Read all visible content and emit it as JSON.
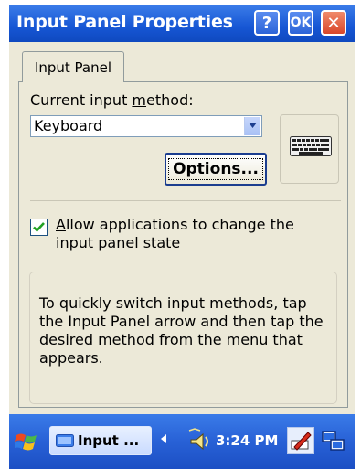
{
  "window": {
    "title": "Input Panel Properties",
    "help_label": "?",
    "ok_label": "OK",
    "close_label": "✕"
  },
  "tabs": [
    {
      "label": "Input Panel",
      "selected": true
    }
  ],
  "input_method": {
    "label_pre": "Current input ",
    "label_mnemonic": "m",
    "label_post": "ethod:",
    "selected_value": "Keyboard",
    "options_button": "Options..."
  },
  "checkbox": {
    "mnemonic": "A",
    "label_rest": "llow applications to change the input panel state",
    "checked": true
  },
  "info": {
    "text": "To quickly switch input methods, tap the Input Panel arrow and then tap the desired method from the menu that appears."
  },
  "taskbar": {
    "task_button_label": "Input ...",
    "clock": "3:24 PM"
  },
  "icons": {
    "start": "windows-flag-icon",
    "keyboard": "keyboard-icon",
    "pen": "input-pen-icon",
    "network": "network-icon",
    "volume": "speaker-icon"
  },
  "colors": {
    "titlebar": "#1656d4",
    "taskbar": "#2861d6",
    "dialog_bg": "#ece9d8",
    "close_button": "#d9472a"
  }
}
